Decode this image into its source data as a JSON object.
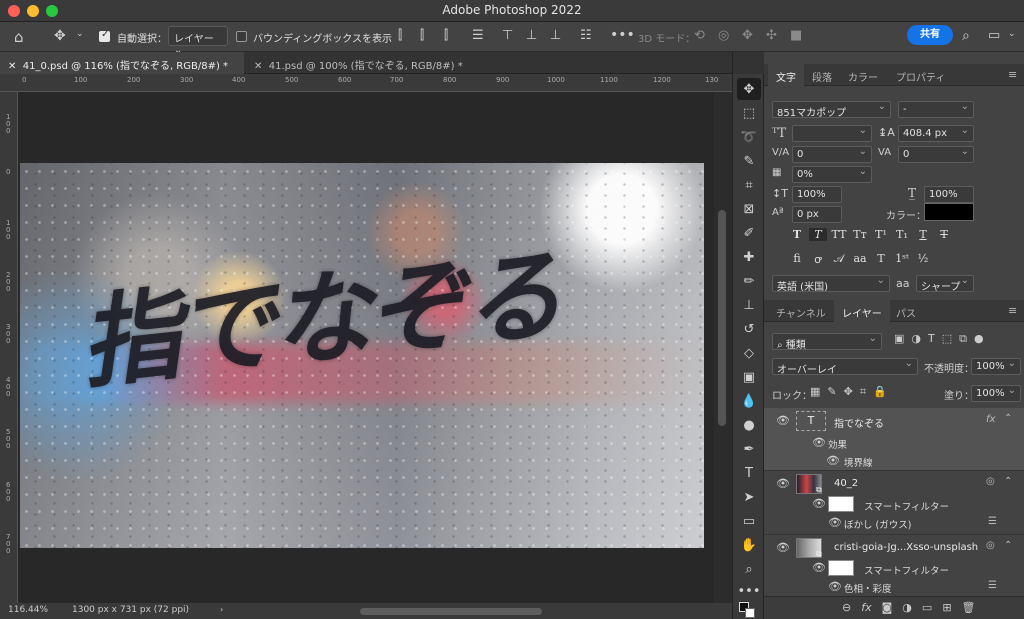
{
  "window": {
    "title": "Adobe Photoshop 2022"
  },
  "options_bar": {
    "auto_select_label": "自動選択：",
    "auto_select_target": "レイヤー",
    "show_bounding_box_label": "バウンディングボックスを表示",
    "three_d_mode_label": "3D モード：",
    "share_label": "共有"
  },
  "tabs": [
    {
      "label": "41_0.psd @ 116% (指でなぞる, RGB/8#) *",
      "active": true
    },
    {
      "label": "41.psd @ 100% (指でなぞる, RGB/8#) *",
      "active": false
    }
  ],
  "ruler": {
    "h_ticks": [
      "0",
      "100",
      "200",
      "300",
      "400",
      "500",
      "600",
      "700",
      "800",
      "900",
      "1000",
      "1100",
      "1200",
      "130"
    ],
    "v_ticks": [
      "1\n0\n0",
      "0",
      "1\n0\n0",
      "2\n0\n0",
      "3\n0\n0",
      "4\n0\n0",
      "5\n0\n0",
      "6\n0\n0",
      "7\n0\n0"
    ]
  },
  "canvas": {
    "text": "指でなぞる"
  },
  "status": {
    "zoom": "116.44%",
    "doc_info": "1300 px x 731 px (72 ppi)"
  },
  "character_panel": {
    "tabs": [
      "文字",
      "段落",
      "カラー",
      "プロパティ"
    ],
    "font_family": "851マカポップ",
    "font_style": "-",
    "font_size": "",
    "leading": "408.4 px",
    "kerning": "0",
    "tracking": "0",
    "tsume": "0%",
    "vertical_scale": "100%",
    "horizontal_scale": "100%",
    "baseline_shift": "0 px",
    "color_label": "カラー：",
    "text_color": "#000000",
    "language": "英語 (米国)",
    "aa_label": "aa",
    "antialias": "シャープ"
  },
  "layers_panel": {
    "tabs": [
      "チャンネル",
      "レイヤー",
      "パス"
    ],
    "filter_kind": "種類",
    "blend_mode": "オーバーレイ",
    "opacity_label": "不透明度：",
    "opacity": "100%",
    "lock_label": "ロック：",
    "fill_label": "塗り：",
    "fill": "100%",
    "layers": [
      {
        "name": "指でなぞる",
        "type": "text",
        "fx": "fx",
        "effects_label": "効果",
        "effect": "境界線"
      },
      {
        "name": "40_2",
        "type": "smart",
        "smart_filter_label": "スマートフィルター",
        "filter": "ぼかし (ガウス)"
      },
      {
        "name": "cristi-goia-Jg...Xsso-unsplash",
        "type": "smart",
        "smart_filter_label": "スマートフィルター",
        "filter": "色相・彩度"
      }
    ]
  },
  "colors": {
    "accent": "#1473e6",
    "panel_bg": "#434343",
    "selected_layer": "#535353"
  }
}
